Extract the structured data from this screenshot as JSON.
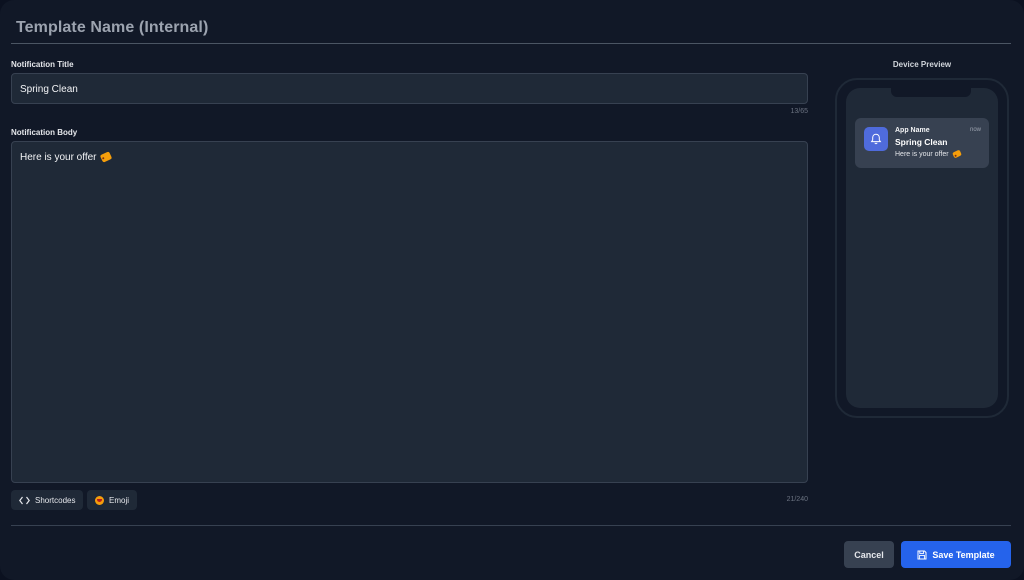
{
  "header": {
    "template_name_placeholder": "Template Name (Internal)"
  },
  "form": {
    "title_label": "Notification Title",
    "title_value": "Spring Clean",
    "title_counter": "13/65",
    "body_label": "Notification Body",
    "body_value": "Here is your offer",
    "body_counter": "21/240",
    "shortcodes_label": "Shortcodes",
    "emoji_label": "Emoji"
  },
  "preview": {
    "label": "Device Preview",
    "app_name": "App Name",
    "time": "now",
    "title": "Spring Clean",
    "body": "Here is your offer"
  },
  "actions": {
    "cancel_label": "Cancel",
    "save_label": "Save Template"
  },
  "icons": {
    "code": "code-icon",
    "emoji": "emoji-icon",
    "bell": "bell-icon",
    "save": "save-icon",
    "offer_tag": "tag-emoji"
  },
  "colors": {
    "background": "#111827",
    "field": "#1f2937",
    "accent": "#2563eb",
    "bell_tile": "#4f6bdc"
  }
}
